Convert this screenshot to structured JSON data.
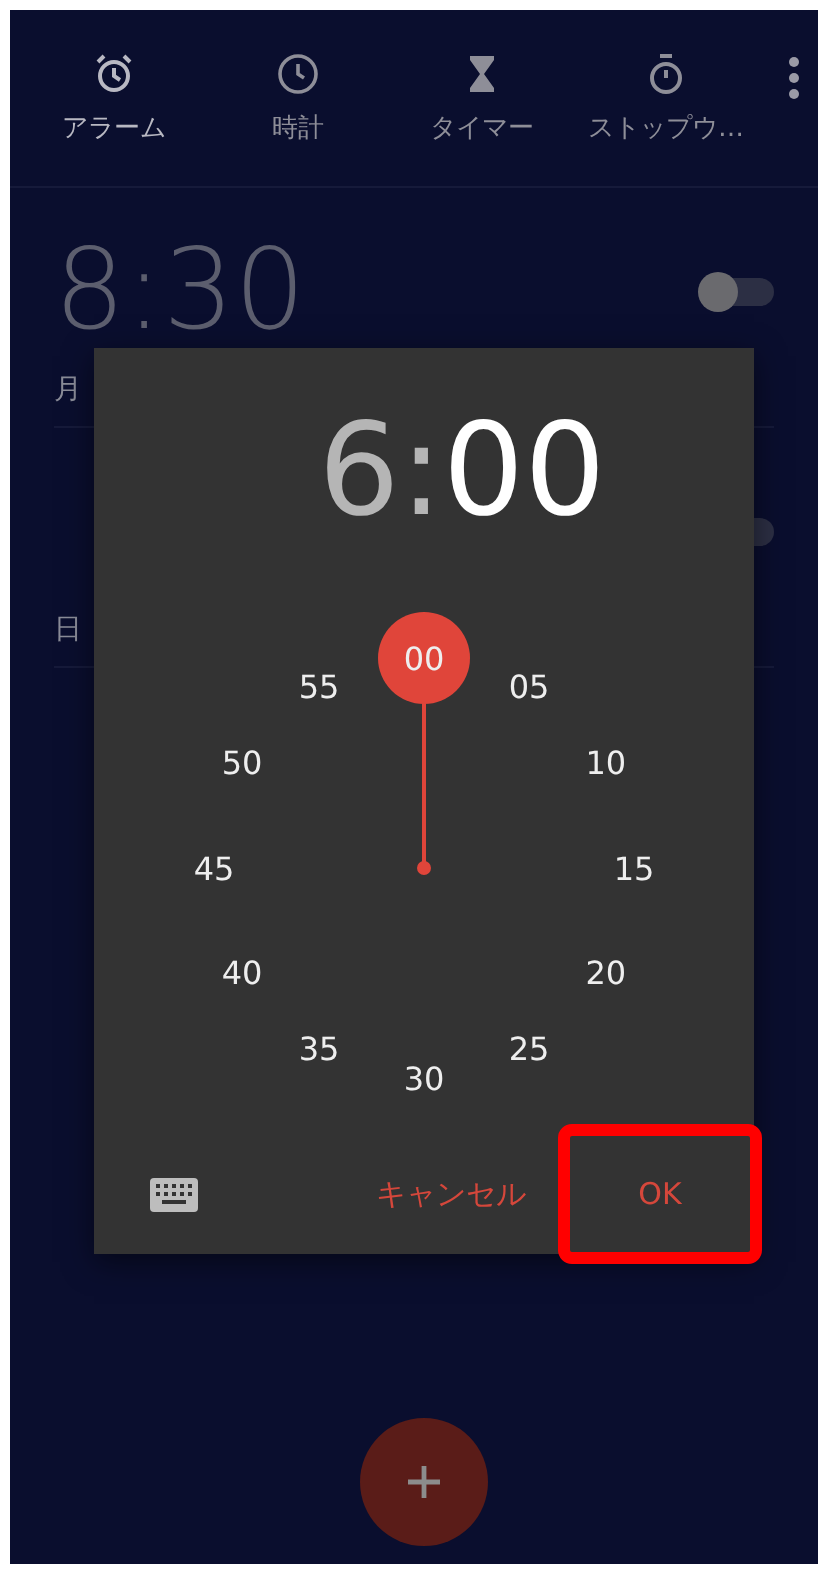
{
  "tabs": [
    {
      "label": "アラーム",
      "kind": "alarm",
      "selected": true
    },
    {
      "label": "時計",
      "kind": "clock",
      "selected": false
    },
    {
      "label": "タイマー",
      "kind": "timer",
      "selected": false
    },
    {
      "label": "ストップウ…",
      "kind": "stopwatch",
      "selected": false
    }
  ],
  "alarms": [
    {
      "time": "8:30",
      "days": "月",
      "on": false
    },
    {
      "days": "日",
      "on": false
    }
  ],
  "dialog": {
    "hour": {
      "text": "6",
      "selected": false
    },
    "separator": ":",
    "minute": {
      "text": "00",
      "selected": true
    },
    "dial": [
      {
        "label": "00",
        "selected": true
      },
      {
        "label": "05",
        "selected": false
      },
      {
        "label": "10",
        "selected": false
      },
      {
        "label": "15",
        "selected": false
      },
      {
        "label": "20",
        "selected": false
      },
      {
        "label": "25",
        "selected": false
      },
      {
        "label": "30",
        "selected": false
      },
      {
        "label": "35",
        "selected": false
      },
      {
        "label": "40",
        "selected": false
      },
      {
        "label": "45",
        "selected": false
      },
      {
        "label": "50",
        "selected": false
      },
      {
        "label": "55",
        "selected": false
      }
    ],
    "buttons": [
      {
        "label": "キャンセル",
        "highlighted": false
      },
      {
        "label": "OK",
        "highlighted": true
      }
    ]
  }
}
